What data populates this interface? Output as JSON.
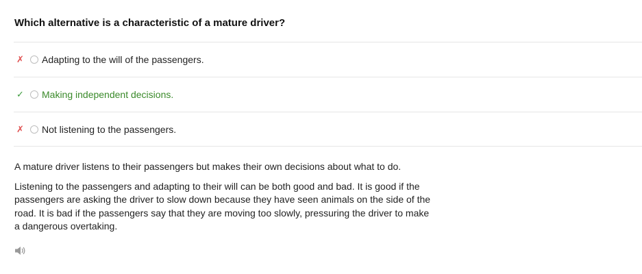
{
  "question": "Which alternative is a characteristic of a mature driver?",
  "answers": [
    {
      "mark": "✗",
      "text": "Adapting to the will of the passengers.",
      "correct": false
    },
    {
      "mark": "✓",
      "text": "Making independent decisions.",
      "correct": true
    },
    {
      "mark": "✗",
      "text": "Not listening to the passengers.",
      "correct": false
    }
  ],
  "explanation": {
    "paragraph1": "A mature driver listens to their passengers but makes their own decisions about what to do.",
    "paragraph2": "Listening to the passengers and adapting to their will can be both good and bad. It is good if the passengers are asking the driver to slow down because they have seen animals on the side of the road. It is bad if the passengers say that they are moving too slowly, pressuring the driver to make a dangerous overtaking."
  },
  "icons": {
    "wrong_mark": "cross-icon",
    "right_mark": "check-icon",
    "audio": "speaker-icon"
  },
  "colors": {
    "wrong": "#e05050",
    "correct": "#3a8a2a"
  }
}
